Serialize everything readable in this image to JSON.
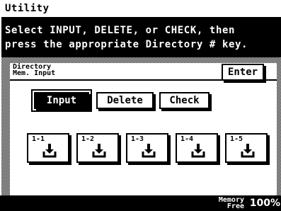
{
  "title": "Utility",
  "banner": {
    "line1": "Select INPUT, DELETE, or CHECK, then",
    "line2": "press the appropriate Directory # key."
  },
  "header": {
    "line1": "Directory",
    "line2": "Mem. Input",
    "enter_label": "Enter"
  },
  "modes": {
    "input": "Input",
    "delete": "Delete",
    "check": "Check",
    "selected": "Input"
  },
  "directory_keys": [
    {
      "label": "1-1",
      "icon": "down-arrow-tray-icon"
    },
    {
      "label": "1-2",
      "icon": "down-arrow-tray-icon"
    },
    {
      "label": "1-3",
      "icon": "down-arrow-tray-icon"
    },
    {
      "label": "1-4",
      "icon": "down-arrow-tray-icon"
    },
    {
      "label": "1-5",
      "icon": "down-arrow-tray-icon"
    }
  ],
  "footer": {
    "memory_label_1": "Memory",
    "memory_label_2": "Free",
    "memory_value": "100%"
  }
}
